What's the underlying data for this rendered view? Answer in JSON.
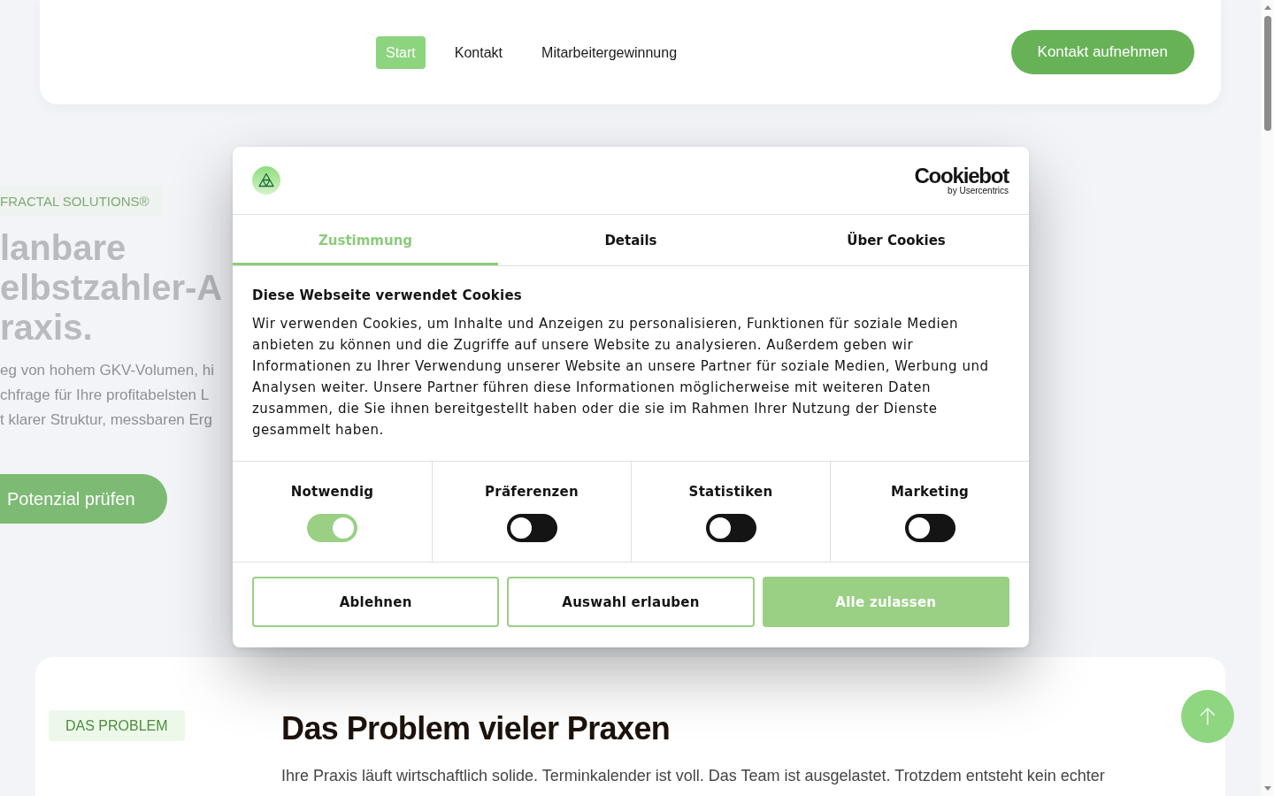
{
  "header": {
    "nav": [
      {
        "label": "Start",
        "selected": true
      },
      {
        "label": "Kontakt",
        "selected": false
      },
      {
        "label": "Mitarbeitergewinnung",
        "selected": false
      }
    ],
    "cta": "Kontakt aufnehmen"
  },
  "hero": {
    "tag": "FRACTAL SOLUTIONS®",
    "heading_lines": [
      "lanbare",
      "elbstzahler-A",
      "raxis."
    ],
    "text_lines": [
      "eg von hohem GKV-Volumen, hi",
      "chfrage für Ihre profitabelsten L",
      "t klarer Struktur, messbaren Erg"
    ],
    "button": "Potenzial prüfen"
  },
  "cookie_dialog": {
    "brand": {
      "name": "Cookiebot",
      "byline": "by Usercentrics"
    },
    "tabs": [
      {
        "label": "Zustimmung",
        "selected": true
      },
      {
        "label": "Details",
        "selected": false
      },
      {
        "label": "Über Cookies",
        "selected": false
      }
    ],
    "title": "Diese Webseite verwendet Cookies",
    "text": "Wir verwenden Cookies, um Inhalte und Anzeigen zu personalisieren, Funktionen für soziale Medien anbieten zu können und die Zugriffe auf unsere Website zu analysieren. Außerdem geben wir Informationen zu Ihrer Verwendung unserer Website an unsere Partner für soziale Medien, Werbung und Analysen weiter. Unsere Partner führen diese Informationen möglicherweise mit weiteren Daten zusammen, die Sie ihnen bereitgestellt haben oder die sie im Rahmen Ihrer Nutzung der Dienste gesammelt haben.",
    "categories": [
      {
        "label": "Notwendig",
        "on": true
      },
      {
        "label": "Präferenzen",
        "on": false
      },
      {
        "label": "Statistiken",
        "on": false
      },
      {
        "label": "Marketing",
        "on": false
      }
    ],
    "buttons": [
      {
        "label": "Ablehnen",
        "kind": "outline"
      },
      {
        "label": "Auswahl erlauben",
        "kind": "outline"
      },
      {
        "label": "Alle zulassen",
        "kind": "filled"
      }
    ]
  },
  "problem_section": {
    "tag": "DAS PROBLEM",
    "heading": "Das Problem vieler Praxen",
    "text": "Ihre Praxis läuft wirtschaftlich solide. Terminkalender ist voll. Das Team ist ausgelastet. Trotzdem entsteht kein echter"
  }
}
